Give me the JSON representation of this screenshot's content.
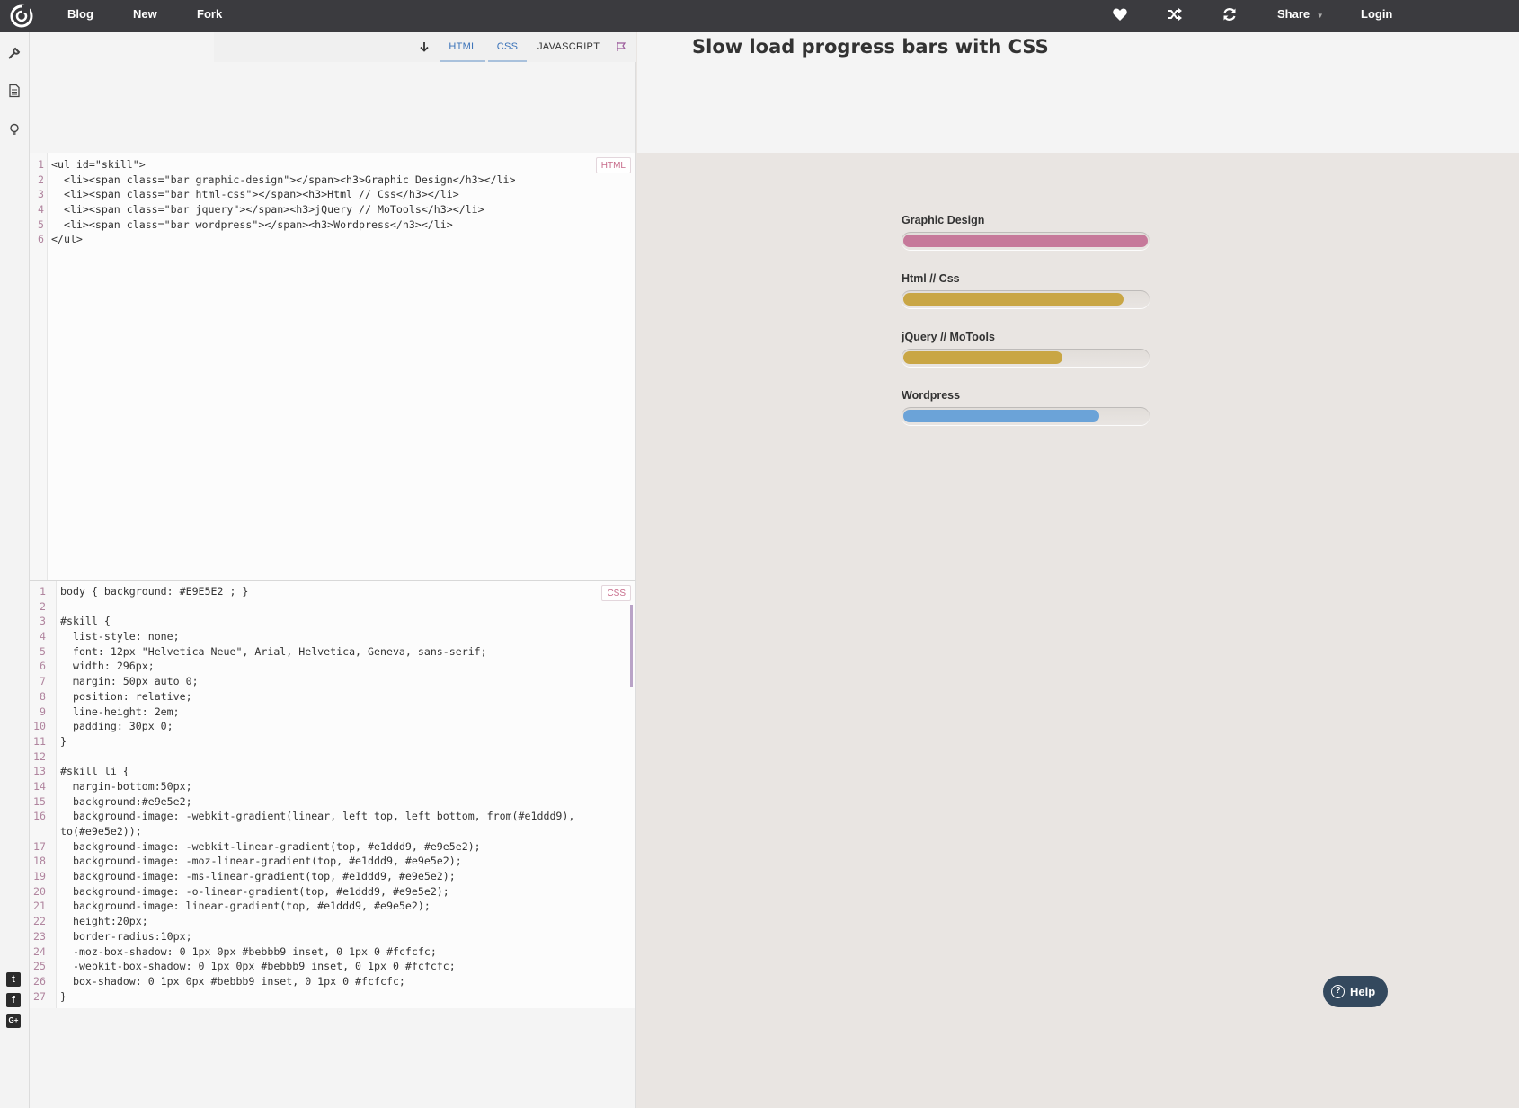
{
  "topbar": {
    "nav": [
      {
        "label": "Blog",
        "icon": "none"
      },
      {
        "label": "New",
        "icon": "none"
      },
      {
        "label": "Fork",
        "icon": "none"
      }
    ],
    "share_label": "Share",
    "login_label": "Login",
    "icons": [
      "heart-icon",
      "shuffle-icon",
      "refresh-icon"
    ]
  },
  "sidebar": {
    "icons": [
      "wrench-icon",
      "document-icon",
      "lightbulb-icon"
    ],
    "social": [
      "twitter-icon",
      "facebook-icon",
      "google-plus-icon"
    ],
    "social_glyphs": {
      "twitter": "t",
      "facebook": "f",
      "gplus": "G+"
    }
  },
  "editor_tabs": {
    "html": "HTML",
    "css": "CSS",
    "javascript": "JAVASCRIPT"
  },
  "html_editor": {
    "badge": "HTML",
    "lines": [
      "<ul id=\"skill\">",
      "  <li><span class=\"bar graphic-design\"></span><h3>Graphic Design</h3></li>",
      "  <li><span class=\"bar html-css\"></span><h3>Html // Css</h3></li>",
      "  <li><span class=\"bar jquery\"></span><h3>jQuery // MoTools</h3></li>",
      "  <li><span class=\"bar wordpress\"></span><h3>Wordpress</h3></li>",
      "</ul>"
    ]
  },
  "css_editor": {
    "badge": "CSS",
    "lines": [
      {
        "n": "1",
        "t": "body { background: #E9E5E2 ; }"
      },
      {
        "n": "2",
        "t": ""
      },
      {
        "n": "3",
        "t": "#skill {"
      },
      {
        "n": "4",
        "t": "  list-style: none;"
      },
      {
        "n": "5",
        "t": "  font: 12px \"Helvetica Neue\", Arial, Helvetica, Geneva, sans-serif;"
      },
      {
        "n": "6",
        "t": "  width: 296px;"
      },
      {
        "n": "7",
        "t": "  margin: 50px auto 0;"
      },
      {
        "n": "8",
        "t": "  position: relative;"
      },
      {
        "n": "9",
        "t": "  line-height: 2em;"
      },
      {
        "n": "10",
        "t": "  padding: 30px 0;"
      },
      {
        "n": "11",
        "t": "}"
      },
      {
        "n": "12",
        "t": ""
      },
      {
        "n": "13",
        "t": "#skill li {"
      },
      {
        "n": "14",
        "t": "  margin-bottom:50px;"
      },
      {
        "n": "15",
        "t": "  background:#e9e5e2;"
      },
      {
        "n": "16",
        "t": "  background-image: -webkit-gradient(linear, left top, left bottom, from(#e1ddd9),"
      },
      {
        "n": "",
        "t": "to(#e9e5e2));"
      },
      {
        "n": "17",
        "t": "  background-image: -webkit-linear-gradient(top, #e1ddd9, #e9e5e2);"
      },
      {
        "n": "18",
        "t": "  background-image: -moz-linear-gradient(top, #e1ddd9, #e9e5e2);"
      },
      {
        "n": "19",
        "t": "  background-image: -ms-linear-gradient(top, #e1ddd9, #e9e5e2);"
      },
      {
        "n": "20",
        "t": "  background-image: -o-linear-gradient(top, #e1ddd9, #e9e5e2);"
      },
      {
        "n": "21",
        "t": "  background-image: linear-gradient(top, #e1ddd9, #e9e5e2);"
      },
      {
        "n": "22",
        "t": "  height:20px;"
      },
      {
        "n": "23",
        "t": "  border-radius:10px;"
      },
      {
        "n": "24",
        "t": "  -moz-box-shadow: 0 1px 0px #bebbb9 inset, 0 1px 0 #fcfcfc;"
      },
      {
        "n": "25",
        "t": "  -webkit-box-shadow: 0 1px 0px #bebbb9 inset, 0 1px 0 #fcfcfc;"
      },
      {
        "n": "26",
        "t": "  box-shadow: 0 1px 0px #bebbb9 inset, 0 1px 0 #fcfcfc;"
      },
      {
        "n": "27",
        "t": "}"
      }
    ]
  },
  "result": {
    "title": "Slow load progress bars with CSS",
    "skills": [
      {
        "label": "Graphic Design",
        "progress": 1.0,
        "color": "#c6799a"
      },
      {
        "label": "Html // Css",
        "progress": 0.9,
        "color": "#c9a645"
      },
      {
        "label": "jQuery // MoTools",
        "progress": 0.65,
        "color": "#c9a645"
      },
      {
        "label": "Wordpress",
        "progress": 0.8,
        "color": "#6ba3d8"
      }
    ]
  },
  "help_label": "Help",
  "help_glyph": "?"
}
